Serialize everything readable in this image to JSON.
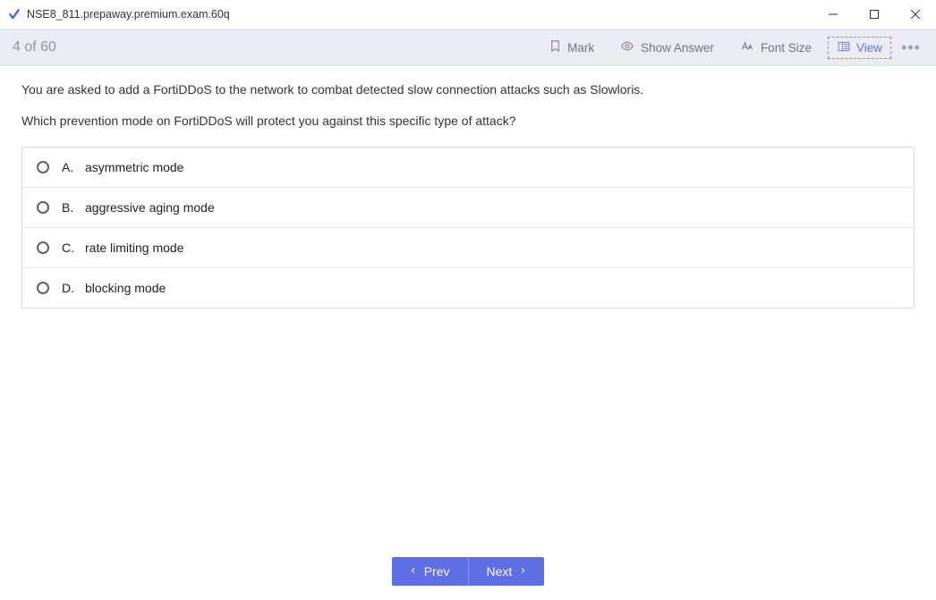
{
  "window": {
    "title": "NSE8_811.prepaway.premium.exam.60q"
  },
  "toolbar": {
    "counter": "4 of 60",
    "mark": "Mark",
    "show_answer": "Show Answer",
    "font_size": "Font Size",
    "view": "View"
  },
  "question": {
    "line1": "You are asked to add a FortiDDoS to the network to combat detected slow connection attacks such as Slowloris.",
    "line2": "Which prevention mode on FortiDDoS will protect you against this specific type of attack?"
  },
  "answers": [
    {
      "letter": "A.",
      "text": "asymmetric mode"
    },
    {
      "letter": "B.",
      "text": "aggressive aging mode"
    },
    {
      "letter": "C.",
      "text": "rate limiting mode"
    },
    {
      "letter": "D.",
      "text": "blocking mode"
    }
  ],
  "nav": {
    "prev": "Prev",
    "next": "Next"
  }
}
